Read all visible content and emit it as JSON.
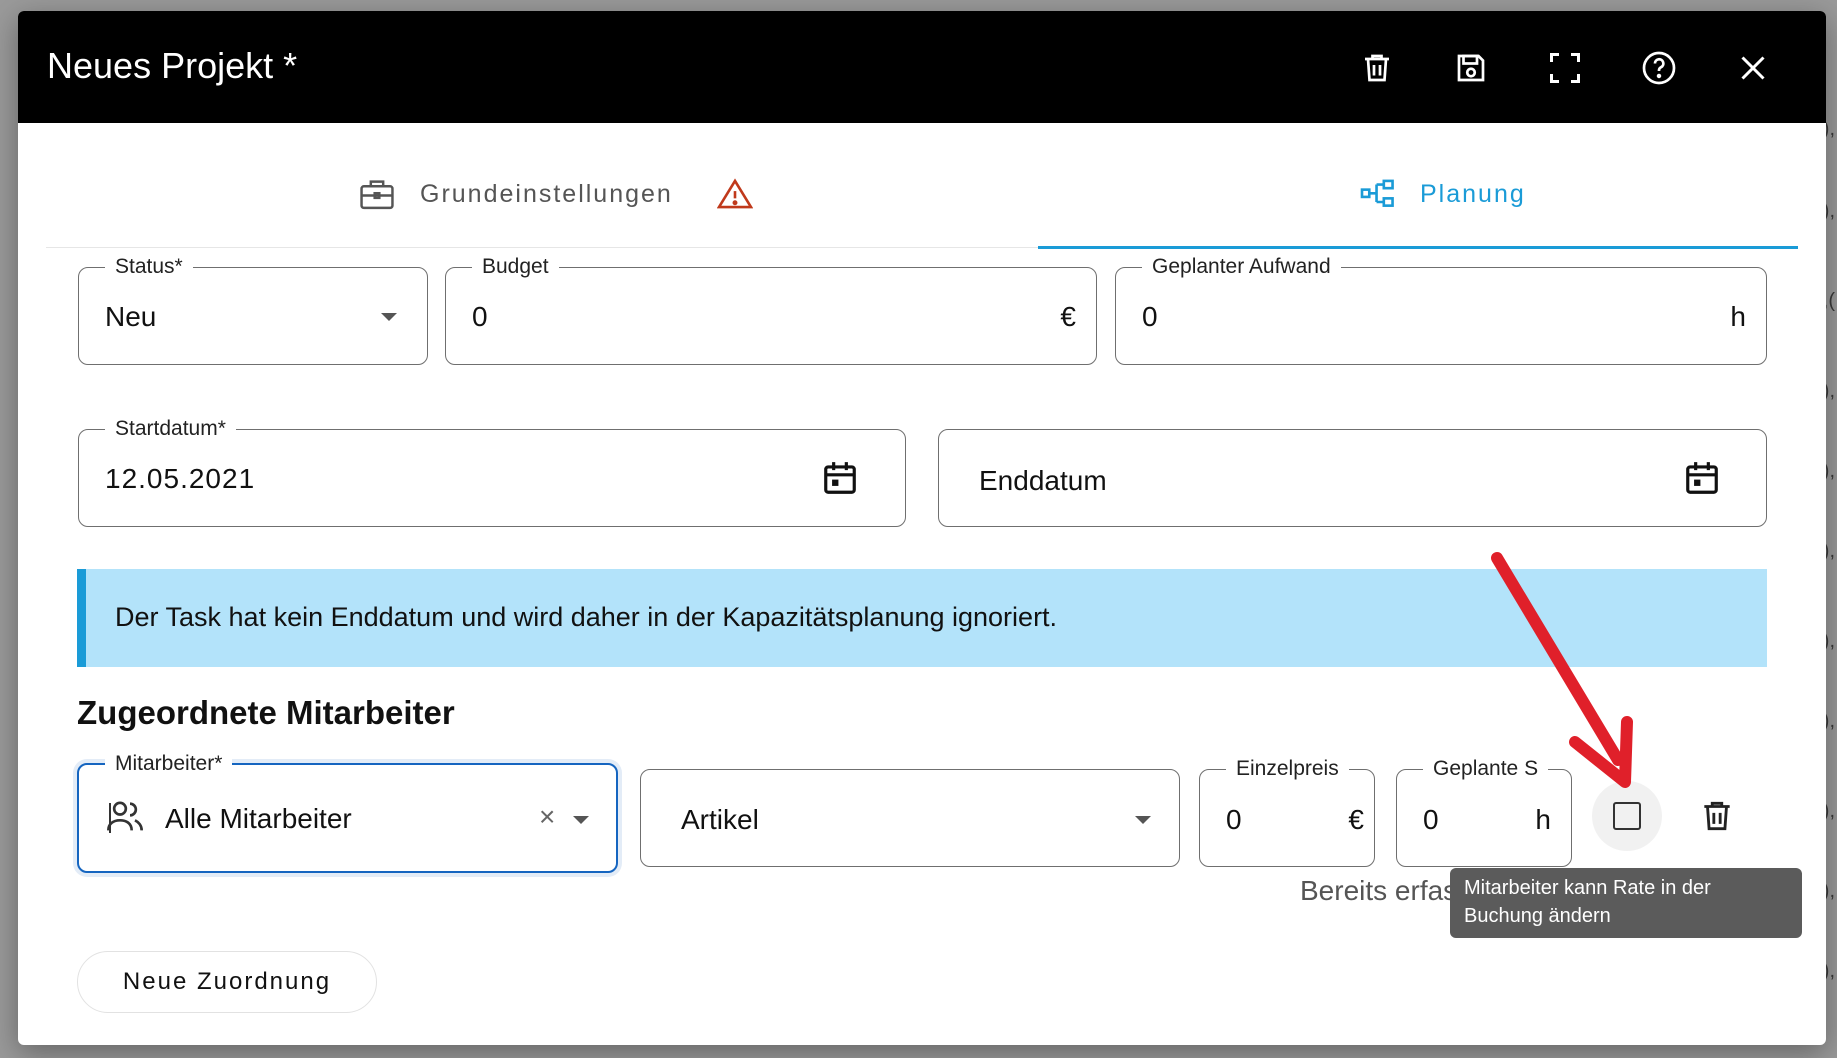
{
  "dialog": {
    "title": "Neues Projekt *"
  },
  "toolbar_icons": [
    "delete-icon",
    "save-icon",
    "fullscreen-icon",
    "help-icon",
    "close-icon"
  ],
  "tabs": [
    {
      "label": "Grundeinstellungen",
      "icon": "briefcase-icon",
      "warning_icon": "warning-icon",
      "active": false
    },
    {
      "label": "Planung",
      "icon": "hierarchy-icon",
      "active": true
    }
  ],
  "fields": {
    "status": {
      "label": "Status*",
      "value": "Neu"
    },
    "budget": {
      "label": "Budget",
      "value": "0",
      "suffix": "€"
    },
    "effort": {
      "label": "Geplanter Aufwand",
      "value": "0",
      "suffix": "h"
    },
    "start_date": {
      "label": "Startdatum*",
      "value": "12.05.2021"
    },
    "end_date": {
      "placeholder": "Enddatum"
    }
  },
  "info_message": "Der Task hat kein Enddatum und wird daher in der Kapazitätsplanung ignoriert.",
  "assigned_section": {
    "title": "Zugeordnete Mitarbeiter",
    "employee": {
      "label": "Mitarbeiter*",
      "value": "Alle Mitarbeiter",
      "clear_glyph": "×"
    },
    "article": {
      "placeholder": "Artikel"
    },
    "unit_price": {
      "label": "Einzelpreis",
      "value": "0",
      "suffix": "€"
    },
    "planned": {
      "label": "Geplante S",
      "value": "0",
      "suffix": "h"
    },
    "already_recorded": "Bereits erfas",
    "tooltip": "Mitarbeiter kann Rate in der Buchung ändern"
  },
  "new_assignment_label": "Neue Zuordnung",
  "colors": {
    "accent": "#1a9bd7",
    "info_bg": "#b3e3fa",
    "warning": "#c0391b",
    "focus": "#1565c0",
    "annotation_arrow": "#e0202a"
  }
}
